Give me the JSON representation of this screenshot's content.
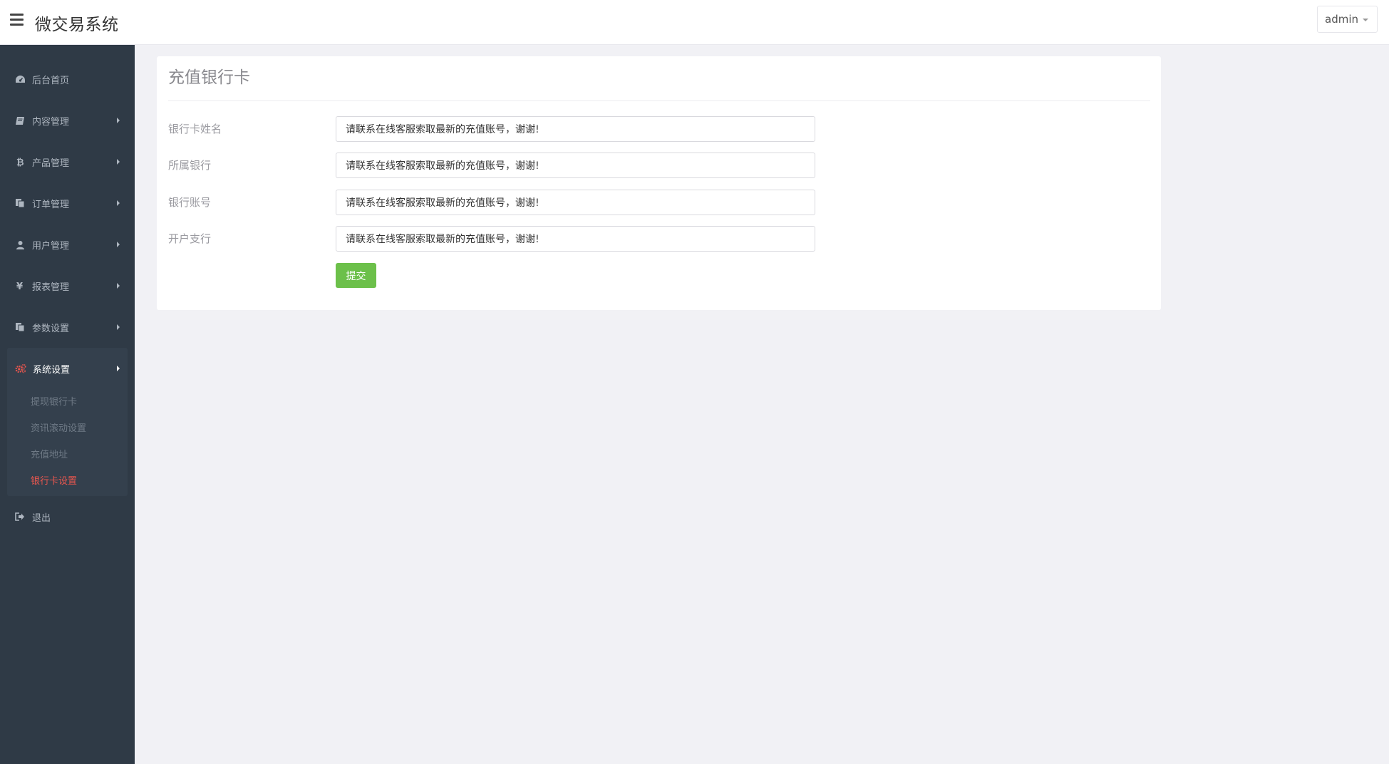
{
  "header": {
    "app_title": "微交易系统",
    "user_name": "admin"
  },
  "sidebar": {
    "items": [
      {
        "label": "后台首页",
        "icon": "dashboard-icon"
      },
      {
        "label": "内容管理",
        "icon": "book-icon"
      },
      {
        "label": "产品管理",
        "icon": "bitcoin-icon"
      },
      {
        "label": "订单管理",
        "icon": "copy-icon"
      },
      {
        "label": "用户管理",
        "icon": "user-icon"
      },
      {
        "label": "报表管理",
        "icon": "yen-icon"
      },
      {
        "label": "参数设置",
        "icon": "files-icon"
      },
      {
        "label": "系统设置",
        "icon": "gears-icon"
      },
      {
        "label": "退出",
        "icon": "sign-out-icon"
      }
    ],
    "system_settings_subitems": [
      {
        "label": "提现银行卡"
      },
      {
        "label": "资讯滚动设置"
      },
      {
        "label": "充值地址"
      },
      {
        "label": "银行卡设置"
      }
    ],
    "active_color": "#e8564e"
  },
  "main": {
    "title": "充值银行卡",
    "fields": [
      {
        "label": "银行卡姓名",
        "value": "请联系在线客服索取最新的充值账号，谢谢!"
      },
      {
        "label": "所属银行",
        "value": "请联系在线客服索取最新的充值账号，谢谢!"
      },
      {
        "label": "银行账号",
        "value": "请联系在线客服索取最新的充值账号，谢谢!"
      },
      {
        "label": "开户支行",
        "value": "请联系在线客服索取最新的充值账号，谢谢!"
      }
    ],
    "submit_label": "提交",
    "submit_color": "#6cc04a"
  }
}
